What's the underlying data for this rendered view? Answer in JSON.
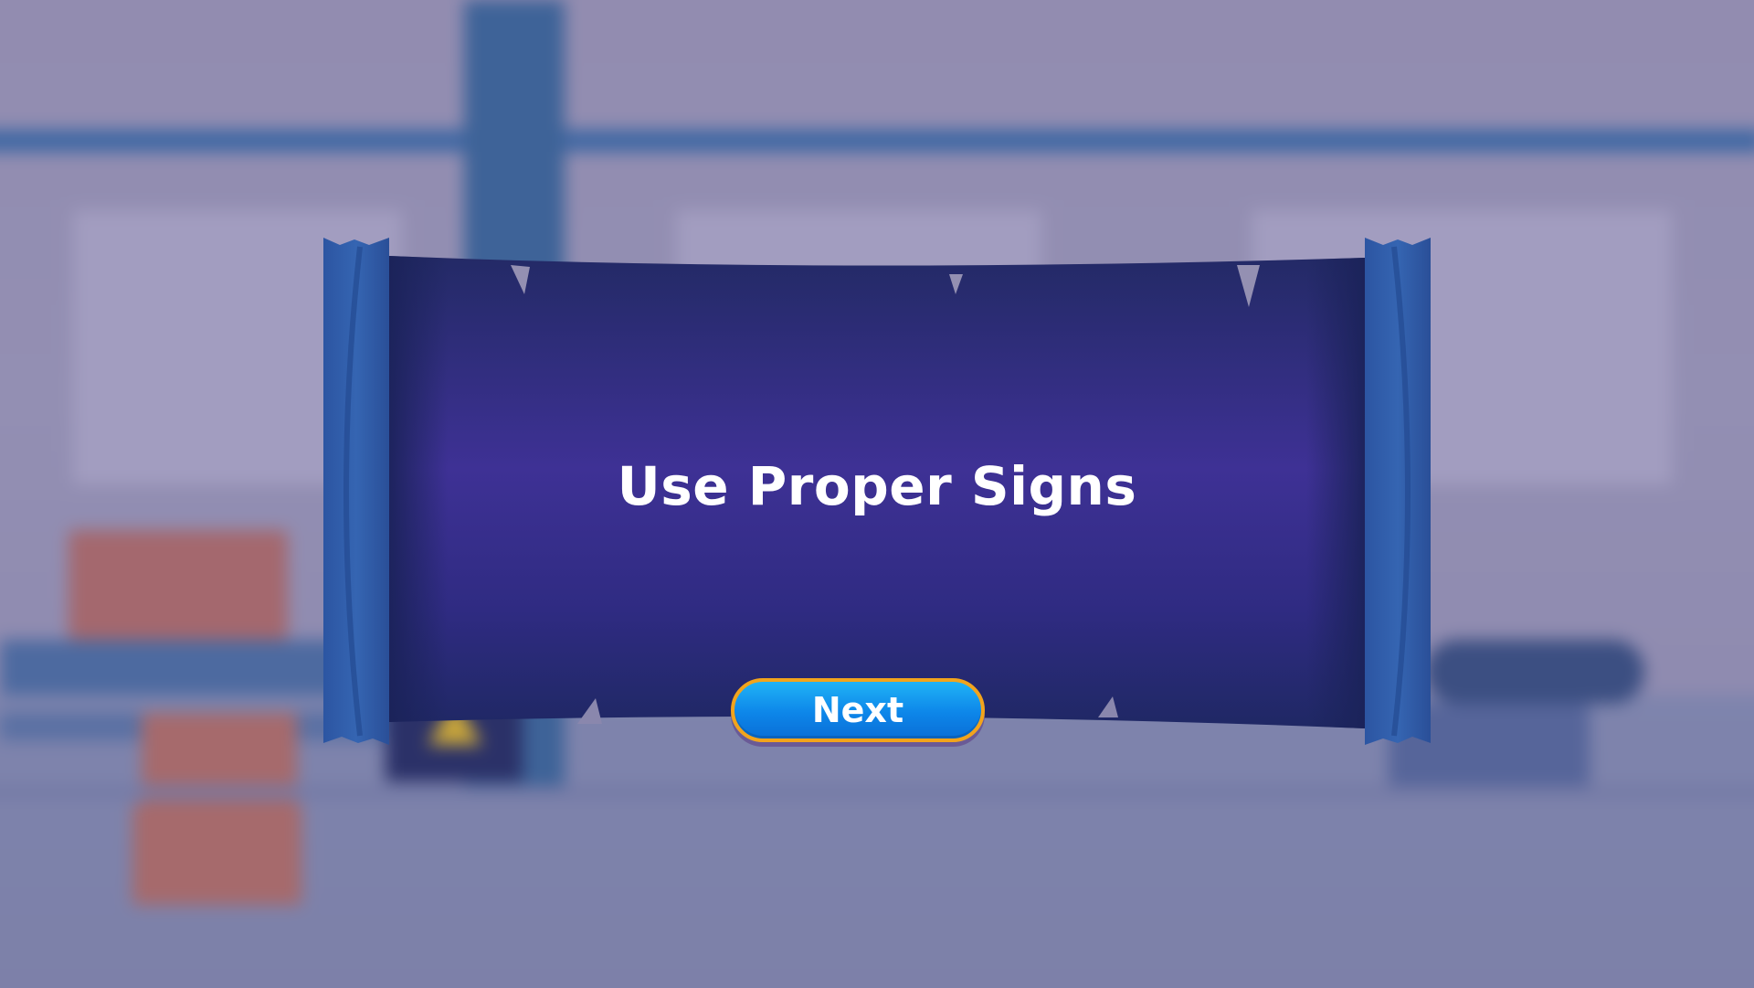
{
  "screen": {
    "title": "Use Proper Signs"
  },
  "actions": {
    "next_label": "Next"
  },
  "colors": {
    "banner_fill": "#2a2f7a",
    "banner_glow": "#42339a",
    "banner_frame": "#2f5aa8",
    "button_fill": "#1099ee",
    "button_border": "#f2a41c",
    "background": "#9490b2"
  }
}
